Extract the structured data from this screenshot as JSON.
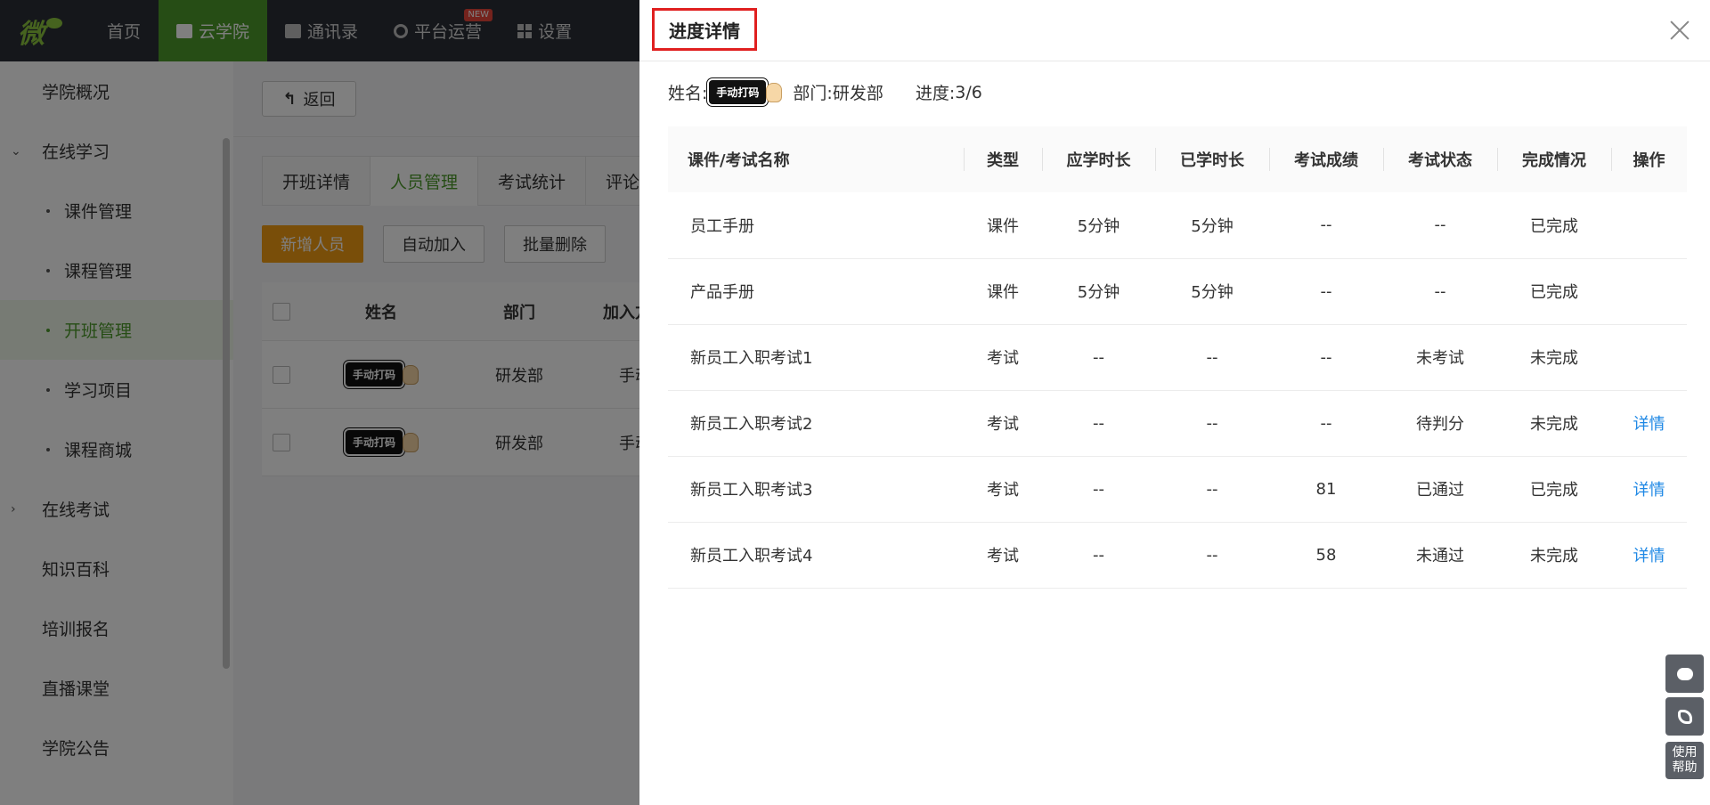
{
  "nav": {
    "logo": "微",
    "items": [
      {
        "label": "首页"
      },
      {
        "label": "云学院"
      },
      {
        "label": "通讯录"
      },
      {
        "label": "平台运营",
        "badge": "NEW"
      },
      {
        "label": "设置"
      }
    ]
  },
  "sidebar": {
    "items": [
      {
        "label": "学院概况"
      },
      {
        "label": "在线学习"
      },
      {
        "label": "课件管理"
      },
      {
        "label": "课程管理"
      },
      {
        "label": "开班管理"
      },
      {
        "label": "学习项目"
      },
      {
        "label": "课程商城"
      },
      {
        "label": "在线考试"
      },
      {
        "label": "知识百科"
      },
      {
        "label": "培训报名"
      },
      {
        "label": "直播课堂"
      },
      {
        "label": "学院公告"
      }
    ]
  },
  "main": {
    "back_label": "返回",
    "tabs": [
      "开班详情",
      "人员管理",
      "考试统计",
      "评论"
    ],
    "actions": [
      "新增人员",
      "自动加入",
      "批量删除"
    ],
    "table": {
      "headers": [
        "姓名",
        "部门",
        "加入方式"
      ],
      "rows": [
        {
          "name_sticker": "手动打码",
          "dept": "研发部",
          "join": "手动"
        },
        {
          "name_sticker": "手动打码",
          "dept": "研发部",
          "join": "手动"
        }
      ]
    }
  },
  "drawer": {
    "title": "进度详情",
    "info": {
      "name_label": "姓名:",
      "name_sticker": "手动打码",
      "dept_label": "部门:",
      "dept_value": "研发部",
      "progress_label": "进度:",
      "progress_value": "3/6"
    },
    "headers": [
      "课件/考试名称",
      "类型",
      "应学时长",
      "已学时长",
      "考试成绩",
      "考试状态",
      "完成情况",
      "操作"
    ],
    "rows": [
      {
        "name": "员工手册",
        "type": "课件",
        "required": "5分钟",
        "learned": "5分钟",
        "score": "--",
        "status": "--",
        "completion": "已完成",
        "action": ""
      },
      {
        "name": "产品手册",
        "type": "课件",
        "required": "5分钟",
        "learned": "5分钟",
        "score": "--",
        "status": "--",
        "completion": "已完成",
        "action": ""
      },
      {
        "name": "新员工入职考试1",
        "type": "考试",
        "required": "--",
        "learned": "--",
        "score": "--",
        "status": "未考试",
        "completion": "未完成",
        "action": ""
      },
      {
        "name": "新员工入职考试2",
        "type": "考试",
        "required": "--",
        "learned": "--",
        "score": "--",
        "status": "待判分",
        "completion": "未完成",
        "action": "详情"
      },
      {
        "name": "新员工入职考试3",
        "type": "考试",
        "required": "--",
        "learned": "--",
        "score": "81",
        "status": "已通过",
        "completion": "已完成",
        "action": "详情"
      },
      {
        "name": "新员工入职考试4",
        "type": "考试",
        "required": "--",
        "learned": "--",
        "score": "58",
        "status": "未通过",
        "completion": "未完成",
        "action": "详情"
      }
    ]
  },
  "floating": {
    "help_line1": "使用",
    "help_line2": "帮助"
  }
}
